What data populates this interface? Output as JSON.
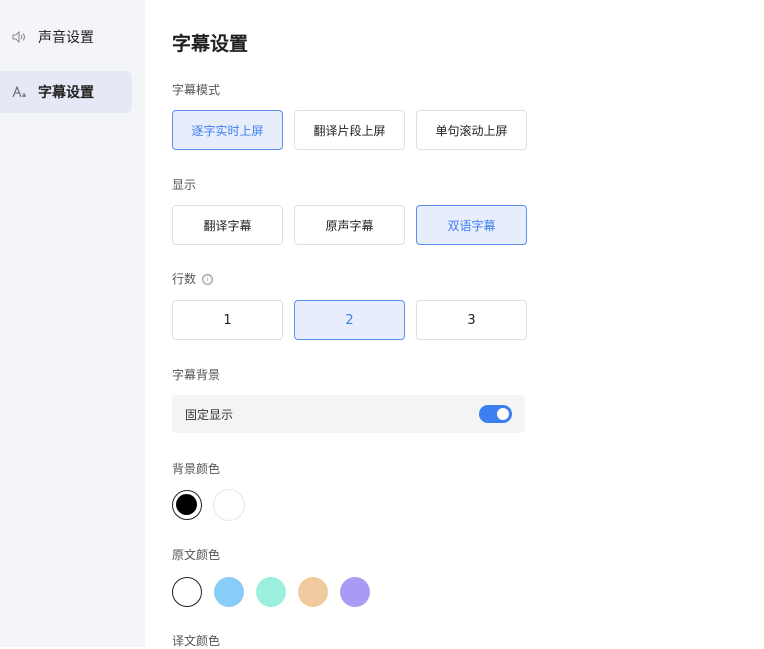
{
  "sidebar": {
    "items": [
      {
        "icon": "speaker-icon",
        "label": "声音设置",
        "active": false
      },
      {
        "icon": "font-size-icon",
        "label": "字幕设置",
        "active": true
      }
    ]
  },
  "main": {
    "title": "字幕设置",
    "mode": {
      "label": "字幕模式",
      "options": [
        "逐字实时上屏",
        "翻译片段上屏",
        "单句滚动上屏"
      ],
      "selected": "逐字实时上屏"
    },
    "display": {
      "label": "显示",
      "options": [
        "翻译字幕",
        "原声字幕",
        "双语字幕"
      ],
      "selected": "双语字幕"
    },
    "lines": {
      "label": "行数",
      "info_icon": "ⓘ",
      "options": [
        "1",
        "2",
        "3"
      ],
      "selected": "2"
    },
    "background": {
      "label": "字幕背景",
      "fixed_label": "固定显示",
      "toggle_on": true
    },
    "bg_color": {
      "label": "背景颜色",
      "colors": [
        "#000000",
        "#ffffff"
      ],
      "selected": "#000000"
    },
    "orig_color": {
      "label": "原文颜色",
      "colors": [
        "#ffffff",
        "#88ccf8",
        "#9af0dc",
        "#f0cba0",
        "#a99af6"
      ],
      "selected": "#ffffff"
    },
    "trans_color": {
      "label": "译文颜色"
    }
  },
  "colors": {
    "accent": "#3d7ef0",
    "selected_bg": "#e7edfb",
    "sidebar_bg": "#f4f5f8"
  }
}
